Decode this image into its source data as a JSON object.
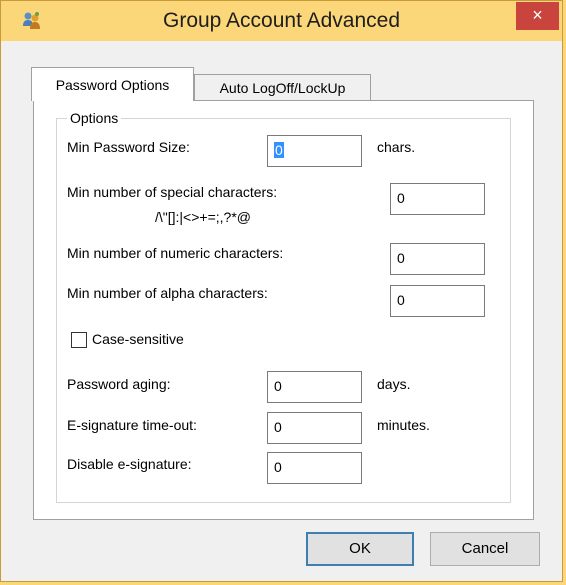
{
  "window": {
    "title": "Group Account Advanced",
    "close_glyph": "×"
  },
  "tabs": [
    {
      "label": "Password Options",
      "active": true
    },
    {
      "label": "Auto LogOff/LockUp",
      "active": false
    }
  ],
  "options": {
    "group_label": "Options",
    "min_password_size": {
      "label": "Min Password Size:",
      "value": "0",
      "unit": "chars."
    },
    "min_special": {
      "label": "Min number of special characters:",
      "chars": "/\\\"[]:|<>+=;,?*@",
      "value": "0"
    },
    "min_numeric": {
      "label": "Min number of numeric characters:",
      "value": "0"
    },
    "min_alpha": {
      "label": "Min number of alpha characters:",
      "value": "0"
    },
    "case_sensitive": {
      "label": "Case-sensitive",
      "checked": false
    },
    "password_aging": {
      "label": "Password aging:",
      "value": "0",
      "unit": "days."
    },
    "esig_timeout": {
      "label": "E-signature time-out:",
      "value": "0",
      "unit": "minutes."
    },
    "disable_esig": {
      "label": "Disable e-signature:",
      "value": "0"
    }
  },
  "buttons": {
    "ok": "OK",
    "cancel": "Cancel"
  },
  "colors": {
    "titlebar": "#fbd77a",
    "close": "#c8443c",
    "selection": "#3390ff"
  },
  "icons": {
    "app": "group-users-icon",
    "close": "close-icon"
  }
}
